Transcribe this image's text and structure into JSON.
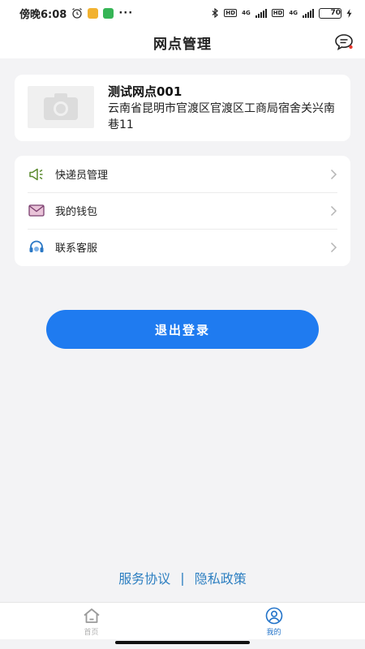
{
  "status_bar": {
    "time": "傍晚6:08",
    "more": "···",
    "network_1": "4G",
    "network_2": "4G",
    "battery": "70"
  },
  "nav": {
    "title": "网点管理"
  },
  "outlet": {
    "name": "测试网点001",
    "address": "云南省昆明市官渡区官渡区工商局宿舍关兴南巷11"
  },
  "menu": {
    "items": [
      {
        "label": "快递员管理",
        "icon": "megaphone-icon"
      },
      {
        "label": "我的钱包",
        "icon": "envelope-icon"
      },
      {
        "label": "联系客服",
        "icon": "headset-icon"
      }
    ]
  },
  "logout": {
    "label": "退出登录"
  },
  "legal": {
    "service": "服务协议",
    "separator": "|",
    "privacy": "隐私政策"
  },
  "tabs": [
    {
      "label": "首页",
      "icon": "home-icon",
      "active": false
    },
    {
      "label": "我的",
      "icon": "user-icon",
      "active": true
    }
  ],
  "colors": {
    "primary": "#1f7bf0",
    "link": "#2d7fc1",
    "tab_active": "#2273c9",
    "background": "#f3f3f5"
  }
}
